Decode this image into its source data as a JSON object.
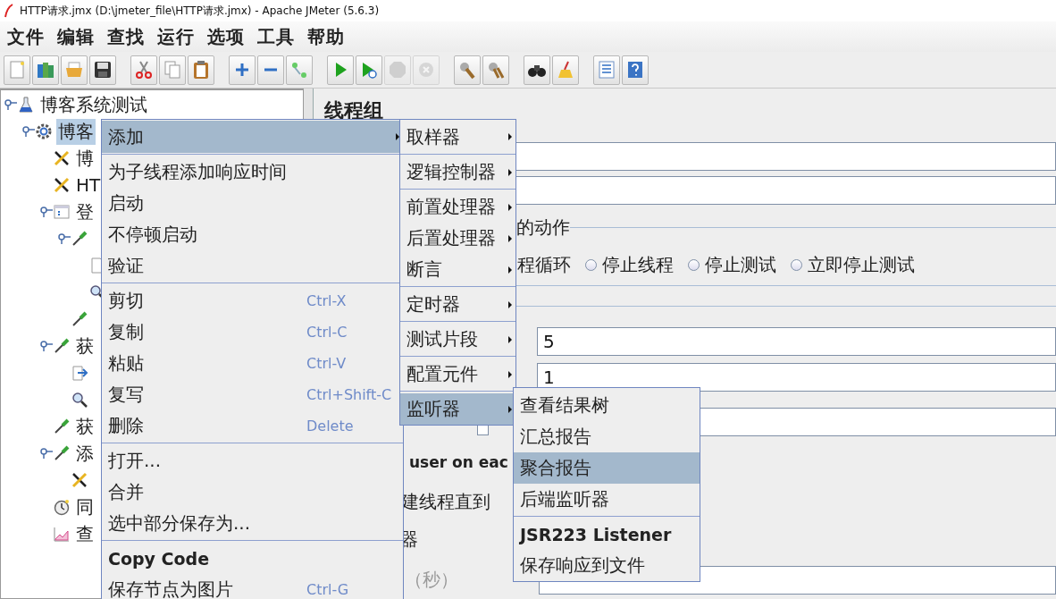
{
  "window": {
    "title": "HTTP请求.jmx (D:\\jmeter_file\\HTTP请求.jmx) - Apache JMeter (5.6.3)"
  },
  "menu_bar": [
    "文件",
    "编辑",
    "查找",
    "运行",
    "选项",
    "工具",
    "帮助"
  ],
  "toolbar": [
    {
      "kind": "new",
      "disabled": false
    },
    {
      "kind": "templates",
      "disabled": false
    },
    {
      "kind": "open",
      "disabled": false
    },
    {
      "kind": "save",
      "disabled": false
    },
    {
      "kind": "cut",
      "disabled": false
    },
    {
      "kind": "copy",
      "disabled": false
    },
    {
      "kind": "paste",
      "disabled": false
    },
    {
      "kind": "expand",
      "disabled": false
    },
    {
      "kind": "collapse",
      "disabled": false
    },
    {
      "kind": "toggle",
      "disabled": false
    },
    {
      "kind": "start",
      "disabled": false
    },
    {
      "kind": "start-no-pause",
      "disabled": false
    },
    {
      "kind": "stop",
      "disabled": true
    },
    {
      "kind": "shutdown",
      "disabled": true
    },
    {
      "kind": "clear",
      "disabled": false
    },
    {
      "kind": "clear-all",
      "disabled": false
    },
    {
      "kind": "search",
      "disabled": false
    },
    {
      "kind": "reset",
      "disabled": false
    },
    {
      "kind": "function",
      "disabled": false
    },
    {
      "kind": "help",
      "disabled": false
    }
  ],
  "tree": [
    {
      "label": "博客系统测试",
      "kind": "test-plan",
      "selected": false,
      "expanded": true,
      "children": [
        {
          "label": "博客",
          "kind": "thread-group",
          "selected": true,
          "expanded": true,
          "children": [
            {
              "label": "博",
              "kind": "config",
              "selected": false
            },
            {
              "label": "HT",
              "kind": "config",
              "selected": false
            },
            {
              "label": "登",
              "kind": "controller",
              "selected": false,
              "expanded": true,
              "children": [
                {
                  "kind": "sampler",
                  "selected": false,
                  "expanded": true,
                  "children": [
                    {
                      "kind": "extractor",
                      "selected": false
                    },
                    {
                      "kind": "assertion",
                      "selected": false
                    }
                  ]
                },
                {
                  "kind": "sampler",
                  "selected": false
                }
              ]
            },
            {
              "label": "获",
              "kind": "sampler",
              "selected": false,
              "expanded": true,
              "children": [
                {
                  "kind": "preprocessor",
                  "selected": false
                },
                {
                  "kind": "assertion",
                  "selected": false
                }
              ]
            },
            {
              "label": "获",
              "kind": "sampler",
              "selected": false
            },
            {
              "label": "添",
              "kind": "sampler",
              "selected": false,
              "expanded": true,
              "children": [
                {
                  "kind": "config",
                  "selected": false
                }
              ]
            },
            {
              "label": "同",
              "kind": "timer",
              "selected": false
            },
            {
              "label": "查",
              "kind": "listener",
              "selected": false
            }
          ]
        }
      ]
    }
  ],
  "editor": {
    "title": "线程组",
    "action_legend": "的动作",
    "action_partial_label": "程循环",
    "action_options": [
      {
        "label": "停止线程",
        "selected": false
      },
      {
        "label": "停止测试",
        "selected": false
      },
      {
        "label": "立即停止测试",
        "selected": false
      }
    ],
    "threads_value": "5",
    "rampup_value": "1",
    "loop_checkbox": {
      "checked": false
    },
    "same_user_text": "user on eac",
    "delay_text": "建线程直到",
    "scheduler_text": "器",
    "duration_text": "（秒）"
  },
  "context_menu": {
    "groups": [
      [
        {
          "label": "添加",
          "kind": "item",
          "selected": true,
          "submenu": true
        }
      ],
      [
        {
          "label": "为子线程添加响应时间",
          "kind": "item",
          "selected": false,
          "submenu": false
        },
        {
          "label": "启动",
          "kind": "item",
          "selected": false,
          "submenu": false
        },
        {
          "label": "不停顿启动",
          "kind": "item",
          "selected": false,
          "submenu": false
        },
        {
          "label": "验证",
          "kind": "item",
          "selected": false,
          "submenu": false
        }
      ],
      [
        {
          "label": "剪切",
          "shortcut": "Ctrl-X",
          "kind": "item",
          "selected": false,
          "submenu": false
        },
        {
          "label": "复制",
          "shortcut": "Ctrl-C",
          "kind": "item",
          "selected": false,
          "submenu": false
        },
        {
          "label": "粘贴",
          "shortcut": "Ctrl-V",
          "kind": "item",
          "selected": false,
          "submenu": false
        },
        {
          "label": "复写",
          "shortcut": "Ctrl+Shift-C",
          "kind": "item",
          "selected": false,
          "submenu": false
        },
        {
          "label": "删除",
          "shortcut": "Delete",
          "kind": "item",
          "selected": false,
          "submenu": false
        }
      ],
      [
        {
          "label": "打开...",
          "kind": "item",
          "selected": false,
          "submenu": false
        },
        {
          "label": "合并",
          "kind": "item",
          "selected": false,
          "submenu": false
        },
        {
          "label": "选中部分保存为...",
          "kind": "item",
          "selected": false,
          "submenu": false
        }
      ],
      [
        {
          "label": "Copy Code",
          "kind": "plugin",
          "selected": false,
          "submenu": false
        },
        {
          "label": "保存节点为图片",
          "shortcut": "Ctrl-G",
          "kind": "item",
          "selected": false,
          "submenu": false
        }
      ]
    ]
  },
  "add_submenu": {
    "groups": [
      [
        {
          "label": "取样器",
          "kind": "item",
          "selected": false,
          "submenu": true
        }
      ],
      [
        {
          "label": "逻辑控制器",
          "kind": "item",
          "selected": false,
          "submenu": true
        }
      ],
      [
        {
          "label": "前置处理器",
          "kind": "item",
          "selected": false,
          "submenu": true
        },
        {
          "label": "后置处理器",
          "kind": "item",
          "selected": false,
          "submenu": true
        },
        {
          "label": "断言",
          "kind": "item",
          "selected": false,
          "submenu": true
        }
      ],
      [
        {
          "label": "定时器",
          "kind": "item",
          "selected": false,
          "submenu": true
        }
      ],
      [
        {
          "label": "测试片段",
          "kind": "item",
          "selected": false,
          "submenu": true
        }
      ],
      [
        {
          "label": "配置元件",
          "kind": "item",
          "selected": false,
          "submenu": true
        }
      ],
      [
        {
          "label": "监听器",
          "kind": "item",
          "selected": true,
          "submenu": true
        }
      ]
    ]
  },
  "listener_submenu": {
    "groups": [
      [
        {
          "label": "查看结果树",
          "kind": "item",
          "selected": false,
          "submenu": false
        },
        {
          "label": "汇总报告",
          "kind": "item",
          "selected": false,
          "submenu": false
        },
        {
          "label": "聚合报告",
          "kind": "item",
          "selected": true,
          "submenu": false
        },
        {
          "label": "后端监听器",
          "kind": "item",
          "selected": false,
          "submenu": false
        }
      ],
      [
        {
          "label": "JSR223 Listener",
          "kind": "plugin",
          "selected": false,
          "submenu": false
        },
        {
          "label": "保存响应到文件",
          "kind": "item",
          "selected": false,
          "submenu": false
        }
      ]
    ]
  }
}
